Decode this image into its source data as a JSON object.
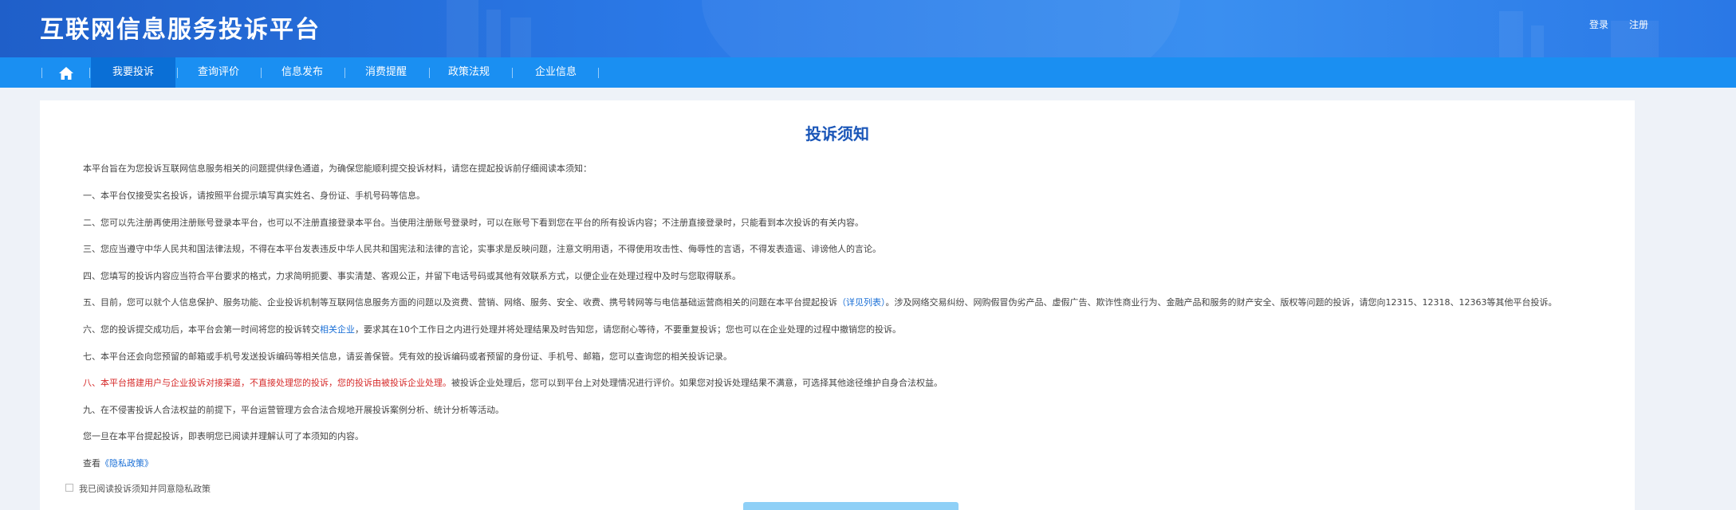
{
  "header": {
    "title": "互联网信息服务投诉平台",
    "login": "登录",
    "register": "注册"
  },
  "nav": {
    "home_icon": "home-icon",
    "items": [
      "我要投诉",
      "查询评价",
      "信息发布",
      "消费提醒",
      "政策法规",
      "企业信息"
    ],
    "active": "我要投诉"
  },
  "notice": {
    "title": "投诉须知",
    "intro": "本平台旨在为您投诉互联网信息服务相关的问题提供绿色通道，为确保您能顺利提交投诉材料，请您在提起投诉前仔细阅读本须知：",
    "item1": "一、本平台仅接受实名投诉，请按照平台提示填写真实姓名、身份证、手机号码等信息。",
    "item2": "二、您可以先注册再使用注册账号登录本平台，也可以不注册直接登录本平台。当使用注册账号登录时，可以在账号下看到您在平台的所有投诉内容；不注册直接登录时，只能看到本次投诉的有关内容。",
    "item3": "三、您应当遵守中华人民共和国法律法规，不得在本平台发表违反中华人民共和国宪法和法律的言论，实事求是反映问题，注意文明用语，不得使用攻击性、侮辱性的言语，不得发表造谣、诽谤他人的言论。",
    "item4": "四、您填写的投诉内容应当符合平台要求的格式，力求简明扼要、事实清楚、客观公正，并留下电话号码或其他有效联系方式，以便企业在处理过程中及时与您取得联系。",
    "item5_a": "五、目前，您可以就个人信息保护、服务功能、企业投诉机制等互联网信息服务方面的问题以及资费、营销、网络、服务、安全、收费、携号转网等与电信基础运营商相关的问题在本平台提起投诉",
    "item5_link": "（详见列表）",
    "item5_b": "。涉及网络交易纠纷、网购假冒伪劣产品、虚假广告、欺诈性商业行为、金融产品和服务的财产安全、版权等问题的投诉，请您向12315、12318、12363等其他平台投诉。",
    "item6_a": "六、您的投诉提交成功后，本平台会第一时间将您的投诉转交",
    "item6_link": "相关企业",
    "item6_b": "，要求其在10个工作日之内进行处理并将处理结果及时告知您，请您耐心等待，不要重复投诉；您也可以在企业处理的过程中撤销您的投诉。",
    "item7": "七、本平台还会向您预留的邮箱或手机号发送投诉编码等相关信息，请妥善保管。凭有效的投诉编码或者预留的身份证、手机号、邮箱，您可以查询您的相关投诉记录。",
    "item8_red": "八、本平台搭建用户与企业投诉对接渠道，不直接处理您的投诉，您的投诉由被投诉企业处理。",
    "item8_b": "被投诉企业处理后，您可以到平台上对处理情况进行评价。如果您对投诉处理结果不满意，可选择其他途径维护自身合法权益。",
    "item9": "九、在不侵害投诉人合法权益的前提下，平台运营管理方会合法合规地开展投诉案例分析、统计分析等活动。",
    "closing": "您一旦在本平台提起投诉，即表明您已阅读并理解认可了本须知的内容。",
    "privacy_prefix": "查看",
    "privacy_link": "《隐私政策》",
    "agree_label": "我已阅读投诉须知并同意隐私政策"
  },
  "colors": {
    "header_blue": "#2b7ae8",
    "nav_blue": "#1a8ff2",
    "nav_active": "#0a6fd6",
    "title_blue": "#1a56b8",
    "warning_red": "#d62a2a",
    "button_light_blue": "#8fd0f7"
  }
}
